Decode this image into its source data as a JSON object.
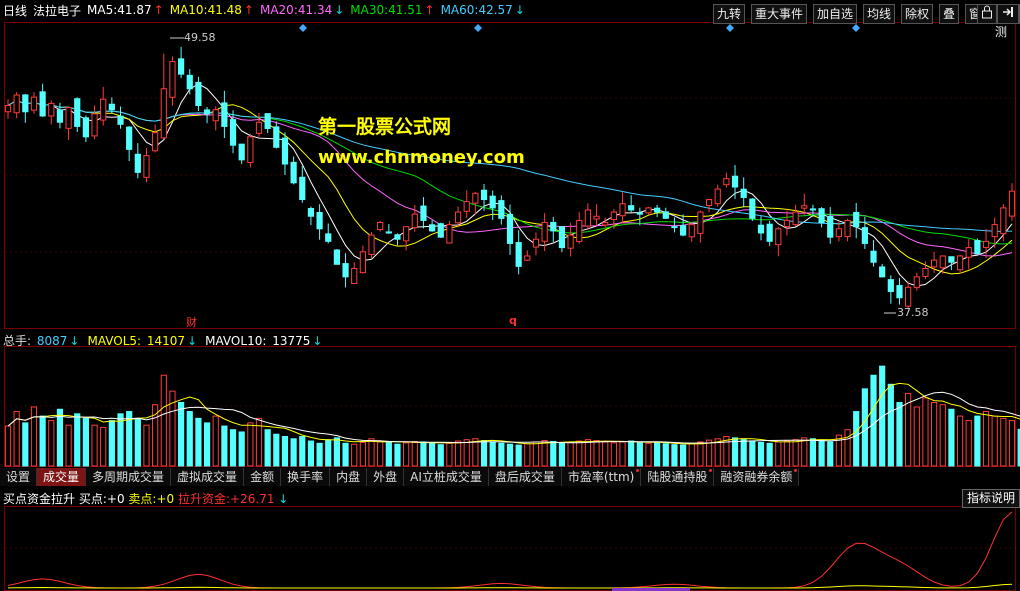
{
  "period_label": "日线",
  "stock_name": "法拉电子",
  "ma_legend": [
    {
      "label": "MA5:",
      "value": "41.87",
      "arrow": "↑",
      "color": "#ffffff",
      "arrow_color": "#ff3030"
    },
    {
      "label": "MA10:",
      "value": "41.48",
      "arrow": "↑",
      "color": "#ffff00",
      "arrow_color": "#ff3030"
    },
    {
      "label": "MA20:",
      "value": "41.34",
      "arrow": "↓",
      "color": "#ff66ff",
      "arrow_color": "#00e0e0"
    },
    {
      "label": "MA30:",
      "value": "41.51",
      "arrow": "↑",
      "color": "#00dd00",
      "arrow_color": "#ff3030"
    },
    {
      "label": "MA60:",
      "value": "42.57",
      "arrow": "↓",
      "color": "#44ccff",
      "arrow_color": "#00e0e0"
    }
  ],
  "toolbar": [
    "九转",
    "重大事件",
    "加自选",
    "均线",
    "除权",
    "叠",
    "窗",
    "预测"
  ],
  "high_label": "49.58",
  "low_label": "37.58",
  "event_marks": [
    "财",
    "q"
  ],
  "watermark": {
    "line1": "第一股票公式网",
    "line2": "www.chnmoney.com"
  },
  "volume_legend": [
    {
      "label": "总手:",
      "value": "8087",
      "arrow": "↓",
      "color": "#dddddd",
      "value_color": "#44ccff"
    },
    {
      "label": "MAVOL5:",
      "value": "14107",
      "arrow": "↓",
      "color": "#ffff00",
      "value_color": "#ffff00"
    },
    {
      "label": "MAVOL10:",
      "value": "13775",
      "arrow": "↓",
      "color": "#ffffff",
      "value_color": "#ffffff"
    }
  ],
  "tabs": [
    {
      "label": "设置",
      "active": false,
      "dot": false
    },
    {
      "label": "成交量",
      "active": true,
      "dot": false
    },
    {
      "label": "多周期成交量",
      "active": false,
      "dot": false
    },
    {
      "label": "虚拟成交量",
      "active": false,
      "dot": false
    },
    {
      "label": "金额",
      "active": false,
      "dot": false
    },
    {
      "label": "换手率",
      "active": false,
      "dot": false
    },
    {
      "label": "内盘",
      "active": false,
      "dot": false
    },
    {
      "label": "外盘",
      "active": false,
      "dot": false
    },
    {
      "label": "AI立桩成交量",
      "active": false,
      "dot": false
    },
    {
      "label": "盘后成交量",
      "active": false,
      "dot": false
    },
    {
      "label": "市盈率(ttm)",
      "active": false,
      "dot": true
    },
    {
      "label": "陆股通持股",
      "active": false,
      "dot": true
    },
    {
      "label": "融资融券余额",
      "active": false,
      "dot": true
    }
  ],
  "indicator_legend": {
    "name": "买点资金拉升",
    "buy_label": "买点:",
    "buy_value": "+0",
    "sell_label": "卖点:",
    "sell_value": "+0",
    "pull_label": "拉升资金:",
    "pull_value": "+26.71",
    "pull_arrow": "↓"
  },
  "indicator_help": "指标说明",
  "chart_data": [
    {
      "type": "candlestick",
      "title": "",
      "ylim": [
        36.5,
        51.0
      ],
      "high": 49.58,
      "low": 37.58,
      "closes": [
        47.1,
        47.6,
        46.8,
        47.5,
        46.6,
        47.2,
        46.3,
        47.0,
        46.1,
        45.6,
        46.7,
        47.4,
        46.9,
        46.2,
        45.0,
        43.9,
        44.7,
        45.8,
        47.9,
        49.2,
        48.6,
        47.9,
        47.1,
        46.7,
        46.9,
        46.1,
        45.2,
        44.5,
        45.6,
        46.3,
        46.0,
        45.1,
        44.3,
        43.4,
        42.6,
        41.8,
        41.2,
        40.6,
        39.5,
        38.9,
        39.3,
        40.1,
        40.9,
        41.5,
        41.0,
        40.7,
        41.3,
        41.9,
        41.6,
        41.1,
        40.8,
        41.4,
        42.0,
        42.5,
        42.9,
        42.6,
        42.2,
        41.7,
        40.5,
        39.4,
        39.9,
        40.7,
        41.5,
        41.1,
        40.3,
        40.9,
        41.6,
        42.1,
        41.8,
        41.5,
        42.0,
        42.4,
        42.1,
        41.9,
        42.2,
        42.0,
        41.7,
        41.3,
        40.9,
        41.4,
        42.0,
        42.6,
        43.1,
        43.6,
        43.2,
        42.7,
        41.7,
        41.0,
        40.6,
        41.2,
        41.6,
        42.0,
        42.3,
        42.1,
        41.5,
        40.8,
        41.2,
        41.6,
        41.3,
        40.5,
        39.6,
        38.9,
        38.2,
        37.9,
        38.4,
        38.9,
        39.3,
        39.7,
        39.9,
        39.6,
        39.9,
        40.3,
        40.0,
        40.6,
        41.4,
        42.2,
        43.0
      ]
    },
    {
      "type": "bar",
      "title": "",
      "ylim": [
        0,
        26000
      ],
      "volumes": [
        8800,
        12000,
        9500,
        13000,
        11000,
        10000,
        12500,
        9000,
        11500,
        10500,
        9000,
        8500,
        10000,
        11500,
        12000,
        10500,
        9000,
        13500,
        20000,
        16500,
        14000,
        12000,
        10500,
        9500,
        11000,
        8800,
        8000,
        7500,
        9500,
        10500,
        8000,
        7000,
        6500,
        6000,
        6500,
        5500,
        5000,
        5800,
        6200,
        5000,
        4800,
        5200,
        6000,
        5500,
        5200,
        4800,
        5100,
        5400,
        5300,
        5000,
        4700,
        5000,
        5500,
        5800,
        6000,
        5600,
        5300,
        5000,
        4800,
        4600,
        4900,
        5300,
        5600,
        5400,
        5000,
        5200,
        5500,
        5800,
        5600,
        5300,
        5100,
        5300,
        5500,
        5200,
        5000,
        5200,
        4900,
        4700,
        4600,
        4900,
        5300,
        5700,
        6000,
        6500,
        6200,
        5800,
        5500,
        5200,
        5000,
        5300,
        5500,
        5800,
        6200,
        6000,
        5600,
        5300,
        6800,
        8000,
        12000,
        17000,
        20000,
        22000,
        18000,
        14000,
        16000,
        13000,
        15000,
        14000,
        13500,
        12500,
        11000,
        10000,
        11000,
        12000,
        11000,
        10500,
        10000,
        8087
      ]
    },
    {
      "type": "line",
      "title": "",
      "series": [
        {
          "name": "拉升资金",
          "last_value": 26.71
        }
      ]
    }
  ]
}
